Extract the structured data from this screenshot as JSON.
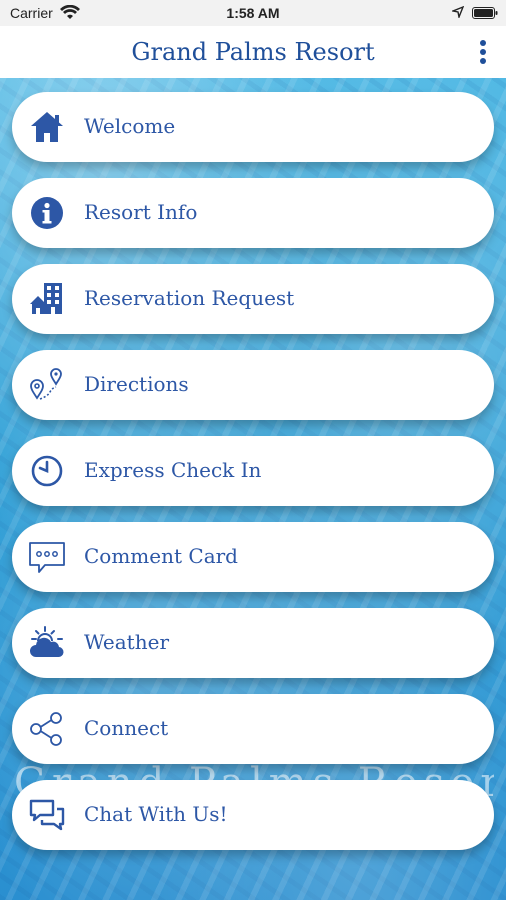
{
  "status_bar": {
    "carrier": "Carrier",
    "time": "1:58 AM"
  },
  "header": {
    "title": "Grand Palms Resort",
    "more_icon": "more-vertical-icon"
  },
  "watermark": "Grand Palms Resort",
  "colors": {
    "accent": "#2d57a6",
    "header_text": "#1f4f9a",
    "background_water": "#2aa6d8"
  },
  "menu": {
    "items": [
      {
        "label": "Welcome",
        "icon": "home-icon"
      },
      {
        "label": "Resort Info",
        "icon": "info-icon"
      },
      {
        "label": "Reservation Request",
        "icon": "building-icon"
      },
      {
        "label": "Directions",
        "icon": "map-pin-icon"
      },
      {
        "label": "Express Check In",
        "icon": "clock-icon"
      },
      {
        "label": "Comment Card",
        "icon": "comment-icon"
      },
      {
        "label": "Weather",
        "icon": "weather-icon"
      },
      {
        "label": "Connect",
        "icon": "share-icon"
      },
      {
        "label": "Chat With Us!",
        "icon": "chat-icon"
      }
    ]
  }
}
